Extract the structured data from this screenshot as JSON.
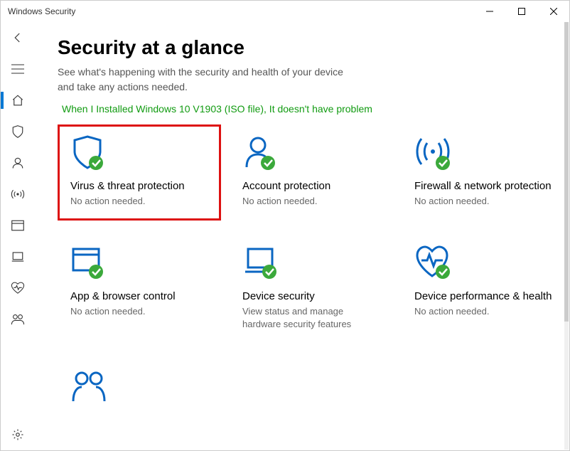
{
  "window": {
    "title": "Windows Security"
  },
  "header": {
    "title": "Security at a glance",
    "subtitle": "See what's happening with the security and health of your device and take any actions needed.",
    "note": "When I Installed Windows 10 V1903 (ISO file), It doesn't have problem"
  },
  "tiles": {
    "virus": {
      "title": "Virus & threat protection",
      "status": "No action needed."
    },
    "account": {
      "title": "Account protection",
      "status": "No action needed."
    },
    "firewall": {
      "title": "Firewall & network protection",
      "status": "No action needed."
    },
    "app": {
      "title": "App & browser control",
      "status": "No action needed."
    },
    "device": {
      "title": "Device security",
      "status": "View status and manage hardware security features"
    },
    "perf": {
      "title": "Device performance & health",
      "status": "No action needed."
    }
  },
  "colors": {
    "accent": "#0078d4",
    "iconBlue": "#0a66c2",
    "ok": "#3ba93b"
  }
}
